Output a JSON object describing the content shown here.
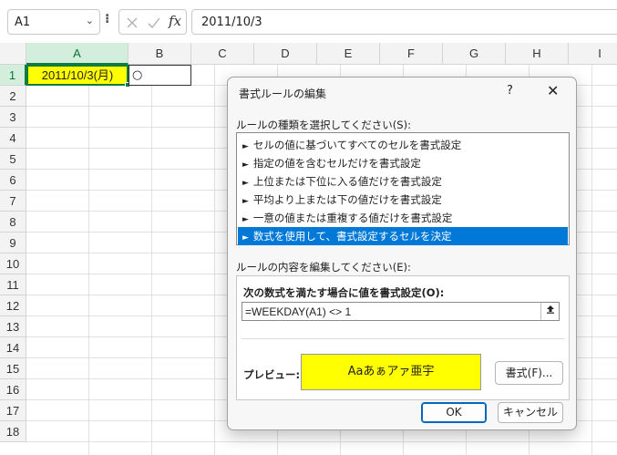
{
  "formula_bar": {
    "name_box": "A1",
    "fx_label": "fx",
    "formula": "2011/10/3"
  },
  "grid": {
    "columns": [
      "A",
      "B",
      "C",
      "D",
      "E",
      "F",
      "G",
      "H",
      "I"
    ],
    "rows": [
      "1",
      "2",
      "3",
      "4",
      "5",
      "6",
      "7",
      "8",
      "9",
      "10",
      "11",
      "12",
      "13",
      "14",
      "15",
      "16",
      "17",
      "18"
    ],
    "cell_a1": "2011/10/3(月)",
    "cell_b1": "○",
    "a1_fill_color": "#ffff00"
  },
  "dialog": {
    "title": "書式ルールの編集",
    "help": "?",
    "close": "✕",
    "rule_type_label": "ルールの種類を選択してください(S):",
    "rule_types": [
      "セルの値に基づいてすべてのセルを書式設定",
      "指定の値を含むセルだけを書式設定",
      "上位または下位に入る値だけを書式設定",
      "平均より上または下の値だけを書式設定",
      "一意の値または重複する値だけを書式設定",
      "数式を使用して、書式設定するセルを決定"
    ],
    "rule_type_arrow": "►",
    "selected_rule_index": 5,
    "edit_label": "ルールの内容を編集してください(E):",
    "condition_label": "次の数式を満たす場合に値を書式設定(O):",
    "formula": "=WEEKDAY(A1) <> 1",
    "preview_label": "プレビュー:",
    "preview_text": "Aaあぁアァ亜宇",
    "preview_color": "#ffff00",
    "format_button": "書式(F)...",
    "ok_button": "OK",
    "cancel_button": "キャンセル",
    "selected_color": "#0078d7"
  }
}
